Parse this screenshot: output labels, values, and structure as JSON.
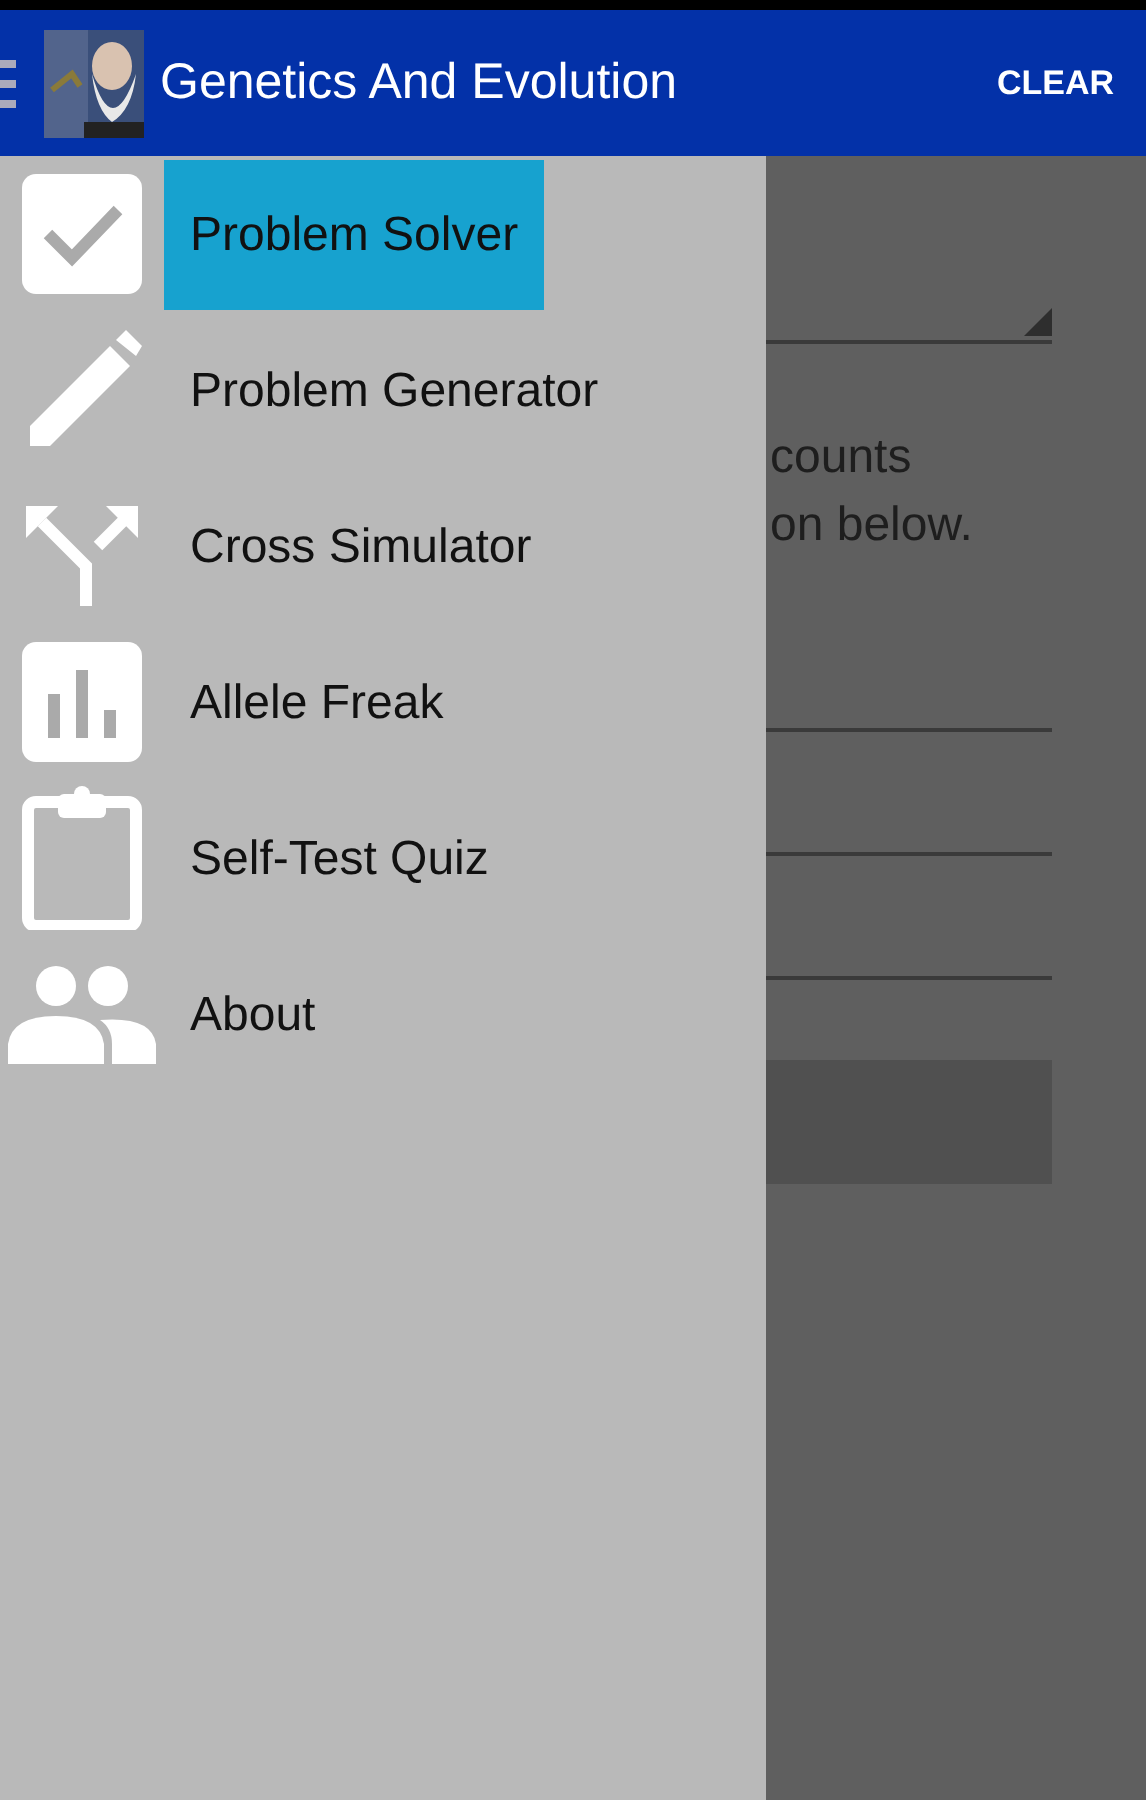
{
  "app_bar": {
    "title": "Genetics And Evolution",
    "action": "CLEAR"
  },
  "content": {
    "instruction_lines": [
      "counts",
      "on below."
    ]
  },
  "drawer": {
    "items": [
      {
        "label": "Problem Solver",
        "selected": true
      },
      {
        "label": "Problem Generator",
        "selected": false
      },
      {
        "label": "Cross Simulator",
        "selected": false
      },
      {
        "label": "Allele Freak",
        "selected": false
      },
      {
        "label": "Self-Test Quiz",
        "selected": false
      },
      {
        "label": "About",
        "selected": false
      }
    ]
  }
}
